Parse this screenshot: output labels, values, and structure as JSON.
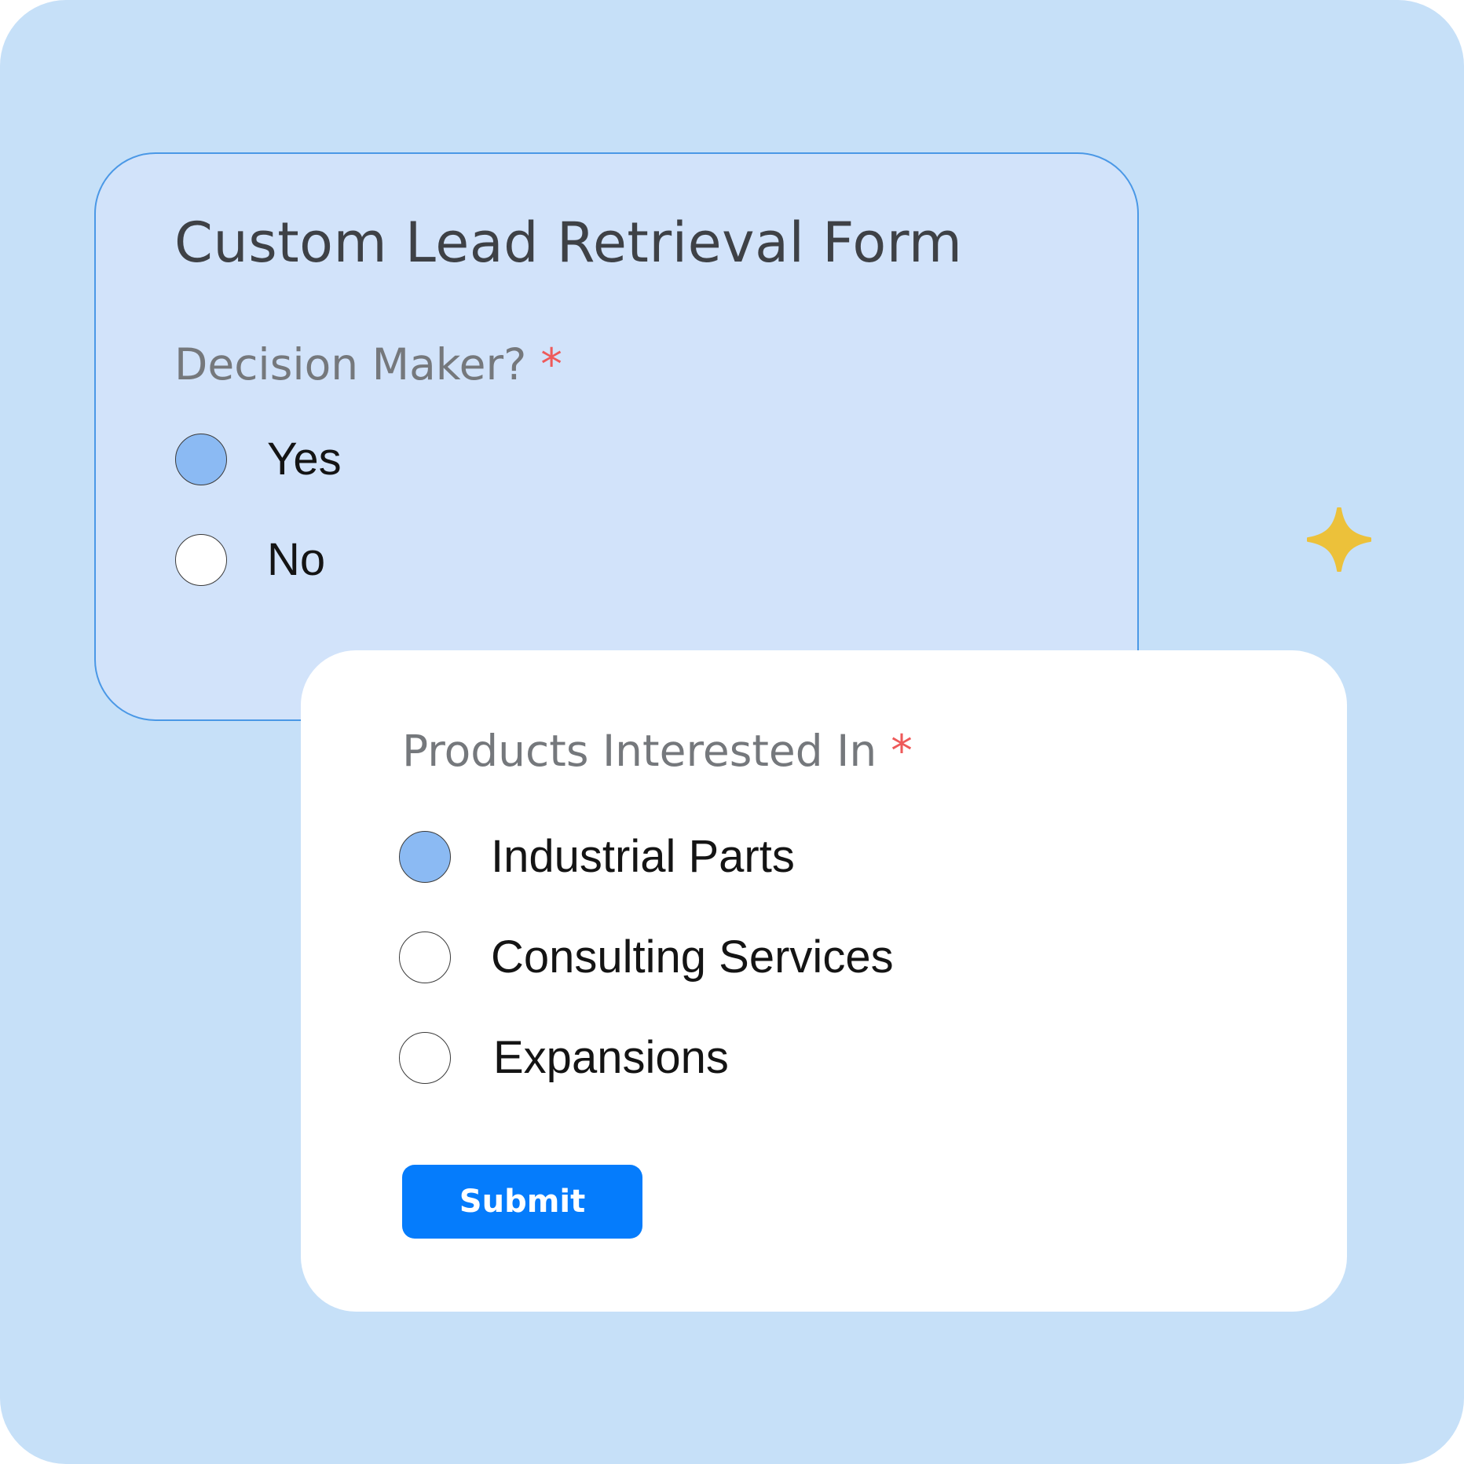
{
  "form": {
    "title": "Custom Lead Retrieval Form",
    "required_marker": "*"
  },
  "decision_maker": {
    "label": "Decision Maker?",
    "options": [
      {
        "label": "Yes",
        "selected": true
      },
      {
        "label": "No",
        "selected": false
      }
    ]
  },
  "products": {
    "label": "Products Interested In",
    "options": [
      {
        "label": "Industrial Parts",
        "selected": true
      },
      {
        "label": "Consulting Services",
        "selected": false
      },
      {
        "label": "Expansions",
        "selected": false
      }
    ]
  },
  "submit_label": "Submit",
  "decorations": {
    "sparkle": "sparkle-star-icon"
  },
  "colors": {
    "background": "#c6e0f8",
    "back_card": "#d2e3fa",
    "back_card_border": "#4a98e6",
    "radio_selected": "#8bbaf3",
    "required": "#ee5a5a",
    "submit": "#057cfc",
    "sparkle": "#ecc13a"
  }
}
